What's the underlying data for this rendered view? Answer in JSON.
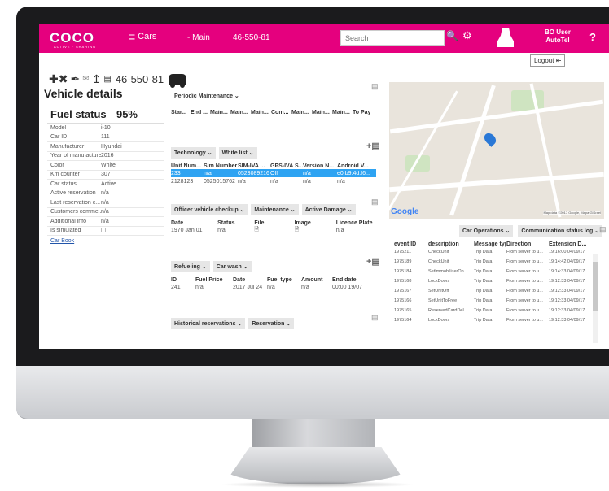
{
  "app": {
    "logo": "COCO",
    "logo_sub": "ACTIVE · SHARING"
  },
  "topbar": {
    "menu_label": "Cars",
    "breadcrumb_main": "Main",
    "breadcrumb_id": "46-550-81",
    "search_placeholder": "Search",
    "user_line1": "BO User",
    "user_line2": "AutoTel",
    "help": "?",
    "logout": "Logout"
  },
  "header": {
    "plate": "46-550-81",
    "title": "Vehicle details"
  },
  "details": {
    "fuel_label": "Fuel status",
    "fuel_value": "95%",
    "rows": [
      {
        "k": "Model",
        "v": "i-10"
      },
      {
        "k": "Car ID",
        "v": "111"
      },
      {
        "k": "Manufacturer",
        "v": "Hyundai"
      },
      {
        "k": "Year of manufacture",
        "v": "2016"
      },
      {
        "k": "Color",
        "v": "White"
      },
      {
        "k": "Km counter",
        "v": "307"
      },
      {
        "k": "Car status",
        "v": "Active"
      },
      {
        "k": "Active reservation",
        "v": "n/a"
      },
      {
        "k": "Last reservation c...",
        "v": "n/a"
      },
      {
        "k": "Customers comme...",
        "v": "n/a"
      },
      {
        "k": "Additional info",
        "v": "n/a"
      },
      {
        "k": "Is simulated",
        "v": ""
      }
    ],
    "car_book": "Car Book"
  },
  "periodic": {
    "tab": "Periodic Maintenance",
    "headers": [
      "Star...",
      "End ...",
      "Main...",
      "Main...",
      "Main...",
      "Com...",
      "Main...",
      "Main...",
      "Main...",
      "To Pay"
    ]
  },
  "technology": {
    "tabs": [
      "Technology",
      "White list"
    ],
    "headers": [
      "Unit Num...",
      "Sim Number",
      "SIM-IVA ...",
      "GPS-IVA S...",
      "Version N...",
      "Android V..."
    ],
    "rows": [
      [
        "233",
        "n/a",
        "0523089216",
        "Off",
        "n/a",
        "e0:b9:4d:f6..."
      ],
      [
        "2128123",
        "0525015762",
        "n/a",
        "n/a",
        "n/a",
        "n/a"
      ]
    ]
  },
  "checkup": {
    "tabs": [
      "Officer vehicle checkup",
      "Maintenance",
      "Active Damage"
    ],
    "headers": [
      "Date",
      "Status",
      "File",
      "Image",
      "Licence Plate"
    ],
    "rows": [
      [
        "1970 Jan 01",
        "n/a",
        "",
        "",
        "n/a"
      ]
    ]
  },
  "refueling": {
    "tabs": [
      "Refueling",
      "Car wash"
    ],
    "headers": [
      "ID",
      "Fuel Price",
      "Date",
      "Fuel type",
      "Amount",
      "End date"
    ],
    "rows": [
      [
        "241",
        "n/a",
        "2017 Jul 24",
        "n/a",
        "n/a",
        "00:00 19/07"
      ]
    ]
  },
  "historical": {
    "tabs": [
      "Historical reservations",
      "Reservation"
    ]
  },
  "map": {
    "credit": "Map data ©2017 Google, Mapa GISrael",
    "logo": "Google"
  },
  "log": {
    "tabs": [
      "Car Operations",
      "Communication status log"
    ],
    "headers": [
      "event ID",
      "description",
      "Message type",
      "Direction",
      "Extension D..."
    ],
    "rows": [
      [
        "1975211",
        "CheckUnit",
        "Trip Data",
        "From server to u...",
        "19:16:00 04/09/17"
      ],
      [
        "1975189",
        "CheckUnit",
        "Trip Data",
        "From server to u...",
        "19:14:42 04/09/17"
      ],
      [
        "1975184",
        "SetImmobilizerOn",
        "Trip Data",
        "From server to u...",
        "19:14:33 04/09/17"
      ],
      [
        "1975168",
        "LockDoors",
        "Trip Data",
        "From server to u...",
        "19:12:33 04/09/17"
      ],
      [
        "1975167",
        "SetUnitOff",
        "Trip Data",
        "From server to u...",
        "19:12:33 04/09/17"
      ],
      [
        "1975166",
        "SetUnitToFree",
        "Trip Data",
        "From server to u...",
        "19:12:33 04/09/17"
      ],
      [
        "1975165",
        "ReservedCardDel...",
        "Trip Data",
        "From server to u...",
        "19:12:33 04/09/17"
      ],
      [
        "1975164",
        "LockDoors",
        "Trip Data",
        "From server to u...",
        "19:12:33 04/09/17"
      ]
    ]
  },
  "colors": {
    "brand": "#e5007e",
    "selected_row": "#2ea3f2",
    "bezel": "#1b1b1d"
  }
}
